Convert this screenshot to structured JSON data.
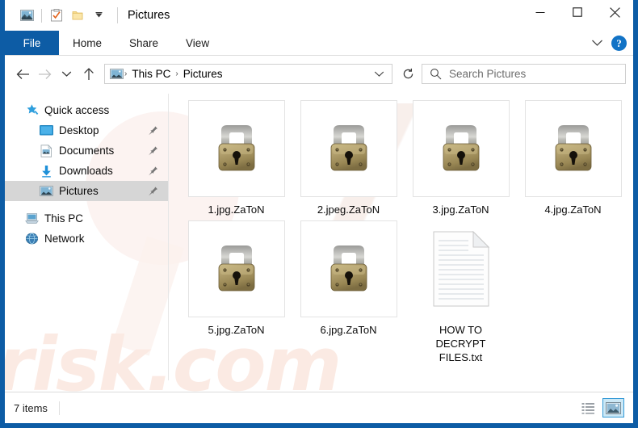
{
  "window": {
    "title": "Pictures",
    "accent_color": "#0d5ca5",
    "quick_access_toolbar": [
      {
        "name": "pictures-folder-icon",
        "label": "Pictures"
      },
      {
        "name": "properties-icon",
        "label": "Properties"
      },
      {
        "name": "new-folder-icon",
        "label": "New folder"
      },
      {
        "name": "customize-dropdown-icon",
        "label": "Customize Quick Access Toolbar"
      }
    ],
    "controls": {
      "minimize": "Minimize",
      "maximize": "Maximize",
      "close": "Close"
    }
  },
  "ribbon": {
    "tabs": [
      {
        "label": "File",
        "selected": true
      },
      {
        "label": "Home",
        "selected": false
      },
      {
        "label": "Share",
        "selected": false
      },
      {
        "label": "View",
        "selected": false
      }
    ],
    "expand_label": "Expand the Ribbon",
    "help_label": "?"
  },
  "navbar": {
    "back_label": "Back",
    "forward_label": "Forward",
    "recent_label": "Recent locations",
    "up_label": "Up",
    "breadcrumbs": [
      {
        "label": "This PC"
      },
      {
        "label": "Pictures"
      }
    ],
    "separator": "›",
    "dropdown_label": "Previous locations",
    "refresh_label": "Refresh"
  },
  "search": {
    "placeholder": "Search Pictures",
    "value": ""
  },
  "sidebar": {
    "items": [
      {
        "label": "Quick access",
        "icon": "star-pin-icon",
        "level": 0,
        "selected": false,
        "pinned": false
      },
      {
        "label": "Desktop",
        "icon": "desktop-icon",
        "level": 1,
        "selected": false,
        "pinned": true
      },
      {
        "label": "Documents",
        "icon": "documents-icon",
        "level": 1,
        "selected": false,
        "pinned": true
      },
      {
        "label": "Downloads",
        "icon": "downloads-icon",
        "level": 1,
        "selected": false,
        "pinned": true
      },
      {
        "label": "Pictures",
        "icon": "pictures-icon",
        "level": 1,
        "selected": true,
        "pinned": true
      },
      {
        "label": "This PC",
        "icon": "this-pc-icon",
        "level": 0,
        "selected": false,
        "pinned": false
      },
      {
        "label": "Network",
        "icon": "network-icon",
        "level": 0,
        "selected": false,
        "pinned": false
      }
    ]
  },
  "files": [
    {
      "name": "1.jpg.ZaToN",
      "icon": "padlock-icon"
    },
    {
      "name": "2.jpeg.ZaToN",
      "icon": "padlock-icon"
    },
    {
      "name": "3.jpg.ZaToN",
      "icon": "padlock-icon"
    },
    {
      "name": "4.jpg.ZaToN",
      "icon": "padlock-icon"
    },
    {
      "name": "5.jpg.ZaToN",
      "icon": "padlock-icon"
    },
    {
      "name": "6.jpg.ZaToN",
      "icon": "padlock-icon"
    },
    {
      "name": "HOW TO DECRYPT FILES.txt",
      "icon": "text-file-icon"
    }
  ],
  "statusbar": {
    "item_count": "7 items",
    "details_view_label": "Details view",
    "thumbnail_view_label": "Large icons view",
    "active_view": "thumbnail"
  },
  "watermark": {
    "text": "risk.com"
  }
}
